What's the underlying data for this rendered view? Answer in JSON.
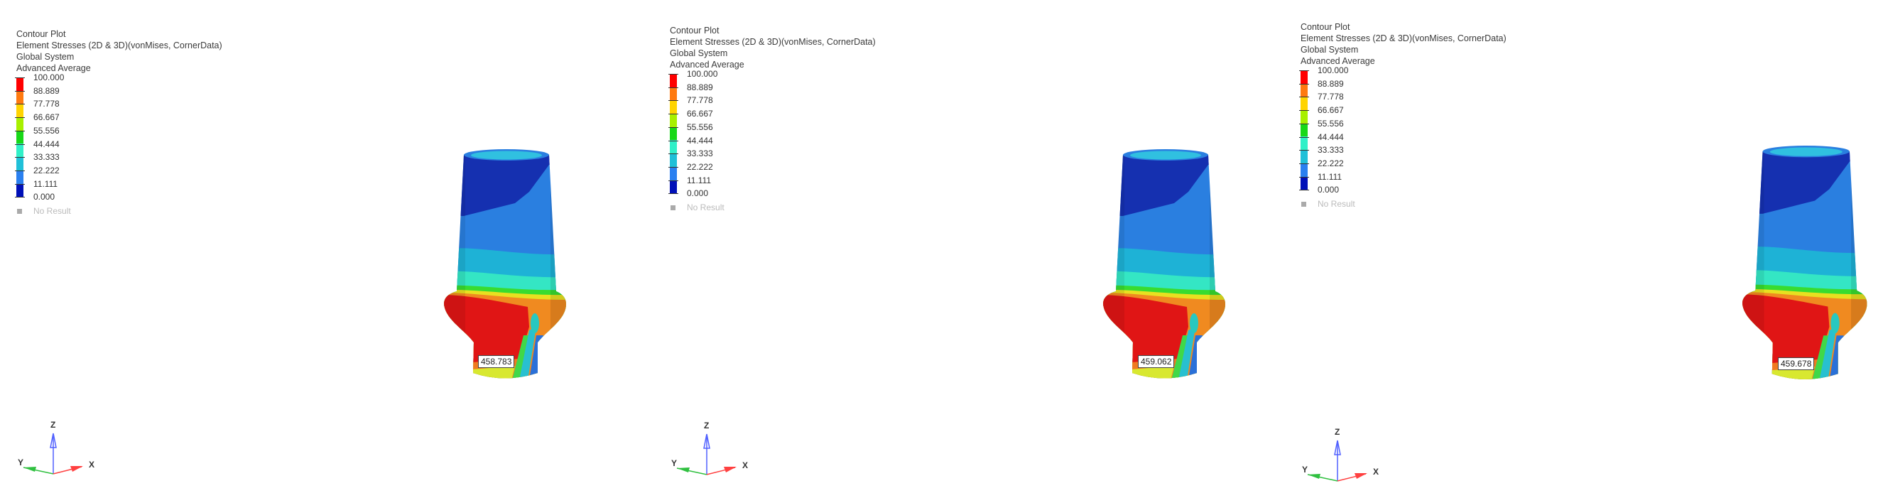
{
  "legend": {
    "title": "Contour Plot",
    "result_type": "Element Stresses (2D & 3D)(vonMises, CornerData)",
    "system": "Global System",
    "averaging": "Advanced Average",
    "levels": [
      "100.000",
      "88.889",
      "77.778",
      "66.667",
      "55.556",
      "44.444",
      "33.333",
      "22.222",
      "11.111",
      "0.000"
    ],
    "band_colors": [
      "#ff0000",
      "#ff7a10",
      "#ffd400",
      "#a8f000",
      "#18d818",
      "#30f0c8",
      "#20c0d8",
      "#2a80f0",
      "#0010b8"
    ],
    "no_result": "No Result"
  },
  "axes": {
    "x": "X",
    "y": "Y",
    "z": "Z"
  },
  "panels": [
    {
      "max_value_label": "458.783"
    },
    {
      "max_value_label": "459.062"
    },
    {
      "max_value_label": "459.678"
    }
  ]
}
